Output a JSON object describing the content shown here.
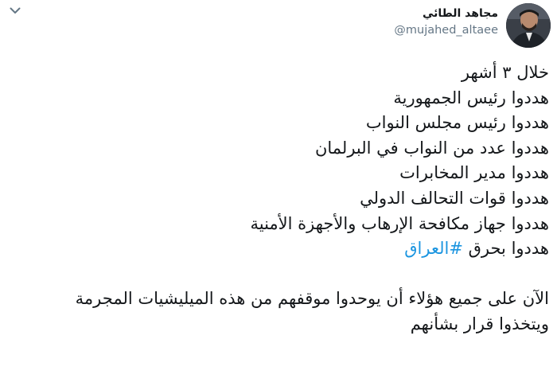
{
  "user": {
    "display_name": "مجاهد الطائي",
    "handle": "@mujahed_altaee"
  },
  "tweet": {
    "lines": [
      "خلال ٣ أشهر",
      "هددوا رئيس الجمهورية",
      "هددوا رئيس مجلس النواب",
      "هددوا عدد من النواب في البرلمان",
      "هددوا مدير المخابرات",
      "هددوا قوات التحالف الدولي",
      "هددوا جهاز مكافحة الإرهاب والأجهزة الأمنية"
    ],
    "line_with_hashtag": {
      "prefix": "هددوا بحرق ",
      "hashtag": "#العراق"
    },
    "closing_lines": [
      "الآن على جميع هؤلاء أن يوحدوا موقفهم من هذه الميليشيات المجرمة",
      "ويتخذوا قرار بشأنهم"
    ]
  },
  "icons": {
    "menu": "chevron-down-icon",
    "avatar": "user-avatar"
  },
  "colors": {
    "text": "#14171a",
    "secondary": "#657786",
    "link": "#1b95e0"
  }
}
